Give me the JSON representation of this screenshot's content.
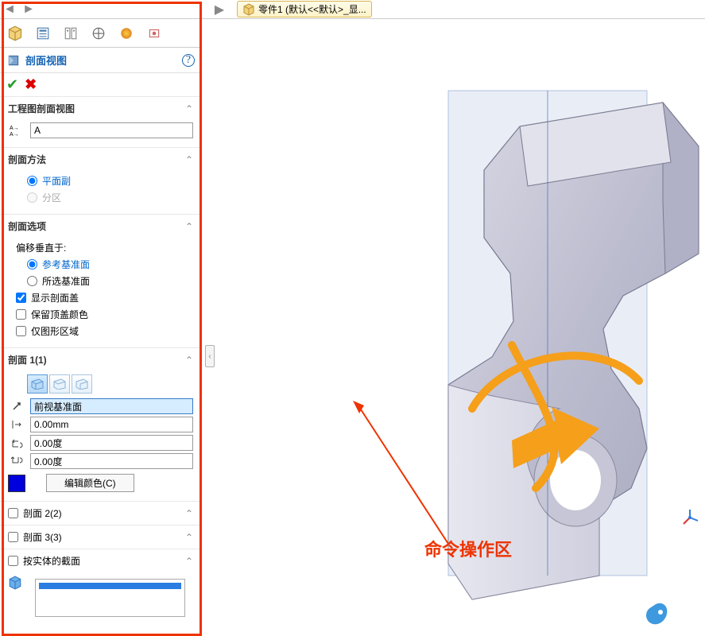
{
  "doc_tab": {
    "label": "零件1  (默认<<默认>_显..."
  },
  "panel": {
    "title": "剖面视图",
    "drawing_section": {
      "title": "工程图剖面视图",
      "value": "A"
    },
    "method_section": {
      "title": "剖面方法",
      "opt_planar": "平面副",
      "opt_zonal": "分区"
    },
    "options_section": {
      "title": "剖面选项",
      "offset_label": "偏移垂直于:",
      "opt_reference": "参考基准面",
      "opt_selected": "所选基准面",
      "chk_cap": "显示剖面盖",
      "chk_keep_color": "保留顶盖颜色",
      "chk_graphics_only": "仅图形区域"
    },
    "section1": {
      "title": "剖面 1(1)",
      "plane_name": "前视基准面",
      "offset": "0.00mm",
      "angle_x": "0.00度",
      "angle_y": "0.00度",
      "edit_color": "编辑颜色(C)"
    },
    "section2": {
      "title": "剖面 2(2)"
    },
    "section3": {
      "title": "剖面 3(3)"
    },
    "by_body": {
      "title": "按实体的截面"
    }
  },
  "annotation": "命令操作区"
}
